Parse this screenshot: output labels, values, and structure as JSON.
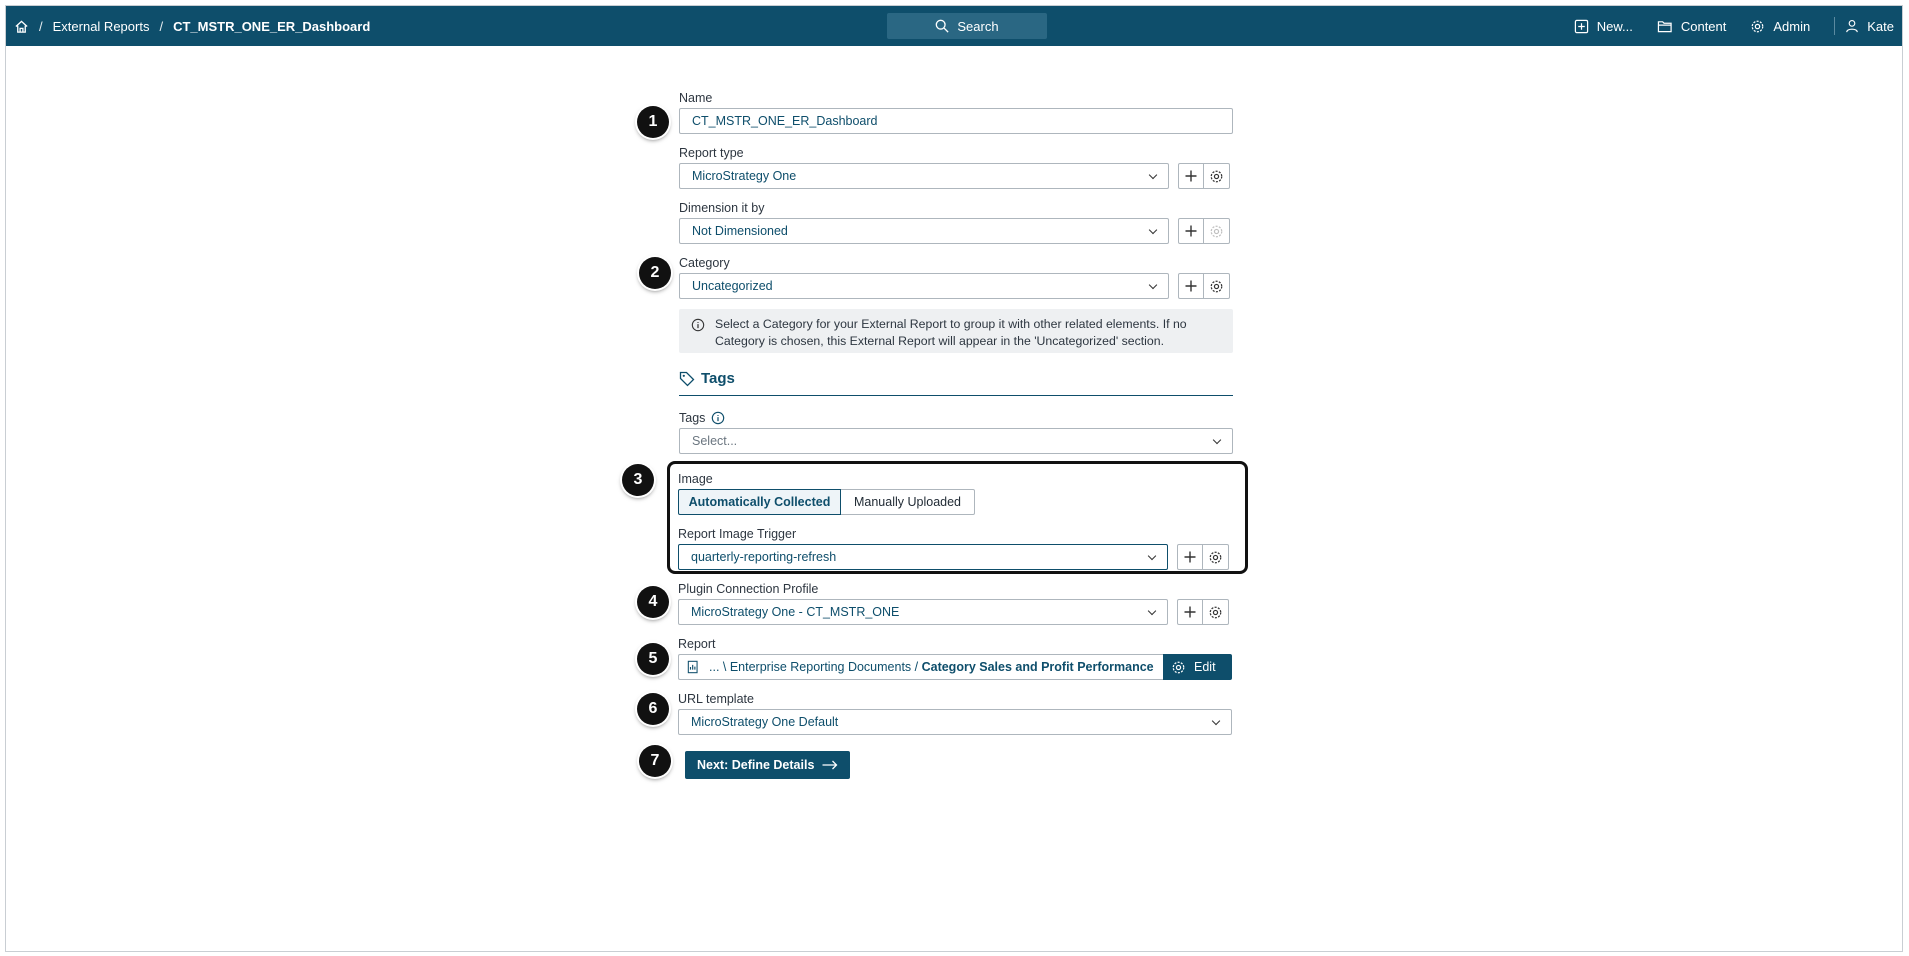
{
  "topbar": {
    "breadcrumb": [
      "External Reports",
      "CT_MSTR_ONE_ER_Dashboard"
    ],
    "search_label": "Search",
    "new_label": "New...",
    "content_label": "Content",
    "admin_label": "Admin",
    "user_label": "Kate"
  },
  "form": {
    "name": {
      "label": "Name",
      "value": "CT_MSTR_ONE_ER_Dashboard"
    },
    "report_type": {
      "label": "Report type",
      "value": "MicroStrategy One"
    },
    "dimension": {
      "label": "Dimension it by",
      "value": "Not Dimensioned"
    },
    "category": {
      "label": "Category",
      "value": "Uncategorized",
      "info": "Select a Category for your External Report to group it with other related elements. If no Category is chosen, this External Report will appear in the 'Uncategorized' section."
    },
    "tags_section": {
      "heading": "Tags",
      "label": "Tags",
      "placeholder": "Select..."
    },
    "image": {
      "label": "Image",
      "options": [
        "Automatically Collected",
        "Manually Uploaded"
      ],
      "selected": "Automatically Collected"
    },
    "report_image_trigger": {
      "label": "Report Image Trigger",
      "value": "quarterly-reporting-refresh"
    },
    "plugin_connection_profile": {
      "label": "Plugin Connection Profile",
      "value": "MicroStrategy One - CT_MSTR_ONE"
    },
    "report": {
      "label": "Report",
      "path": "... \\ Enterprise Reporting Documents / ",
      "name": "Category Sales and Profit Performance",
      "edit_label": "Edit"
    },
    "url_template": {
      "label": "URL template",
      "value": "MicroStrategy One Default"
    },
    "next_button": "Next: Define Details"
  },
  "callouts": [
    "1",
    "2",
    "3",
    "4",
    "5",
    "6",
    "7"
  ],
  "icons": [
    "home-icon",
    "search-icon",
    "new-icon",
    "folder-icon",
    "gear-icon",
    "user-icon",
    "plus-icon",
    "info-icon",
    "tag-icon",
    "report-icon",
    "arrow-right-icon"
  ],
  "colors": {
    "brand": "#0e4e6b",
    "callout": "#111111"
  }
}
